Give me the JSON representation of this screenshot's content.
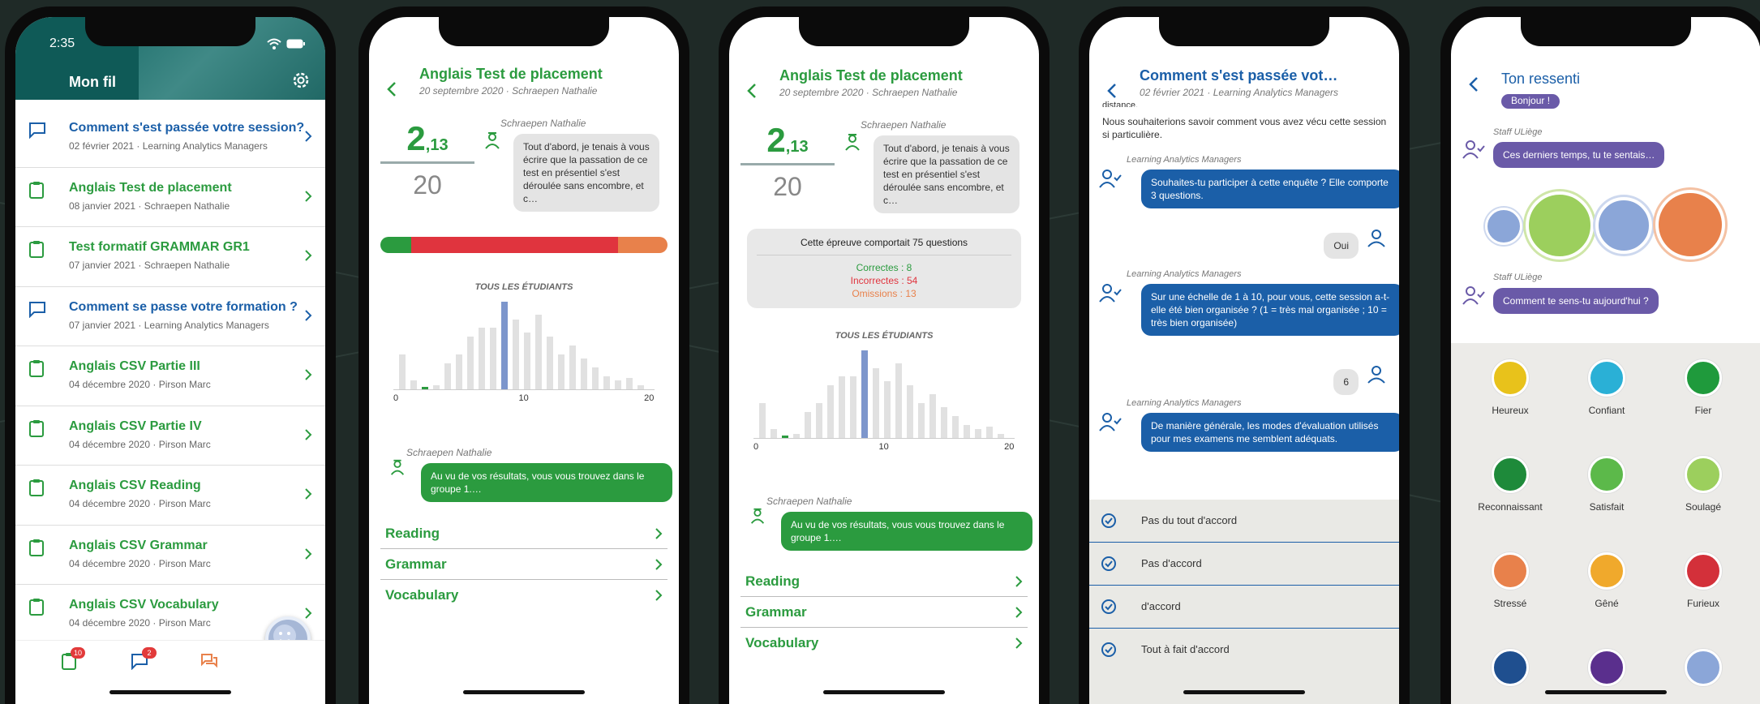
{
  "phone1": {
    "time": "2:35",
    "title": "Mon fil",
    "feed": [
      {
        "title": "Comment s'est passée votre session?",
        "date": "02 février 2021",
        "author": "Learning Analytics Managers",
        "kind": "survey"
      },
      {
        "title": "Anglais Test de placement",
        "date": "08 janvier 2021",
        "author": "Schraepen Nathalie",
        "kind": "test"
      },
      {
        "title": "Test formatif GRAMMAR GR1",
        "date": "07 janvier 2021",
        "author": "Schraepen Nathalie",
        "kind": "test"
      },
      {
        "title": "Comment se passe votre formation ?",
        "date": "07 janvier 2021",
        "author": "Learning Analytics Managers",
        "kind": "survey"
      },
      {
        "title": "Anglais CSV Partie III",
        "date": "04 décembre 2020",
        "author": "Pirson Marc",
        "kind": "test"
      },
      {
        "title": "Anglais CSV Partie IV",
        "date": "04 décembre 2020",
        "author": "Pirson Marc",
        "kind": "test"
      },
      {
        "title": "Anglais CSV Reading",
        "date": "04 décembre 2020",
        "author": "Pirson Marc",
        "kind": "test"
      },
      {
        "title": "Anglais CSV Grammar",
        "date": "04 décembre 2020",
        "author": "Pirson Marc",
        "kind": "test"
      },
      {
        "title": "Anglais CSV Vocabulary",
        "date": "04 décembre 2020",
        "author": "Pirson Marc",
        "kind": "test"
      }
    ],
    "tabs": {
      "tests_badge": "10",
      "messages_badge": "2"
    },
    "sep": "·"
  },
  "test": {
    "title": "Anglais Test de placement",
    "date": "20 septembre 2020",
    "author": "Schraepen Nathalie",
    "score_int": "2",
    "score_dec": ",13",
    "score_max": "20",
    "tutor_name": "Schraepen Nathalie",
    "tutor_msg": "Tout d'abord, je tenais à vous écrire que la passation de ce test en présentiel s'est déroulée sans encombre, et c…",
    "progress": {
      "correct": 8,
      "incorrect": 54,
      "omitted": 13,
      "colors": [
        "#2b9b3f",
        "#e0343e",
        "#e8814b"
      ]
    },
    "stats_title": "Cette épreuve comportait 75 questions",
    "stat_correct": "Correctes : 8",
    "stat_incorrect": "Incorrectes : 54",
    "stat_omitted": "Omissions : 13",
    "hist_caption": "TOUS LES ÉTUDIANTS",
    "hist_ticks": [
      "0",
      "10",
      "20"
    ],
    "hist_values": [
      4,
      1,
      0.3,
      0.5,
      3,
      4,
      6,
      7,
      7,
      10,
      8,
      6.5,
      8.5,
      6,
      4,
      5,
      3.5,
      2.5,
      1.5,
      1,
      1.3,
      0.5
    ],
    "hist_highlight": 9,
    "hist_green": [
      2
    ],
    "result_msg": "Au vu de vos résultats, vous vous trouvez dans le groupe 1.…",
    "links": [
      "Reading",
      "Grammar",
      "Vocabulary"
    ]
  },
  "survey": {
    "title": "Comment s'est passée vot…",
    "date": "02 février 2021",
    "author": "Learning Analytics Managers",
    "cut_top": "distance.",
    "intro": "Nous souhaiterions savoir comment vous avez vécu cette session si particulière.",
    "sender": "Learning Analytics Managers",
    "q1": "Souhaites-tu participer à cette enquête ?  Elle comporte 3 questions.",
    "a1": "Oui",
    "q2": "Sur une échelle de 1 à 10, pour vous, cette session a-t-elle été bien organisée ? (1 = très mal organisée ; 10 = très bien organisée)",
    "a2": "6",
    "q3": "De manière générale, les modes d'évaluation utilisés pour mes examens me semblent adéquats.",
    "options": [
      "Pas du tout d'accord",
      "Pas d'accord",
      "d'accord",
      "Tout à fait d'accord"
    ]
  },
  "feeling": {
    "title": "Ton ressenti",
    "hello": "Bonjour !",
    "staff": "Staff ULiège",
    "m1": "Ces derniers temps, tu te sentais…",
    "m2": "Comment te sens-tu aujourd'hui ?",
    "emotions": [
      {
        "label": "Heureux",
        "color": "#e8c21b"
      },
      {
        "label": "Confiant",
        "color": "#2ab0d6"
      },
      {
        "label": "Fier",
        "color": "#1f9a3c"
      },
      {
        "label": "Reconnaissant",
        "color": "#1e8a3a"
      },
      {
        "label": "Satisfait",
        "color": "#5cb94a"
      },
      {
        "label": "Soulagé",
        "color": "#9ccf5d"
      },
      {
        "label": "Stressé",
        "color": "#e8814b"
      },
      {
        "label": "Gêné",
        "color": "#f0a92c"
      },
      {
        "label": "Furieux",
        "color": "#d3303a"
      },
      {
        "label": "",
        "color": "#1f4f8f"
      },
      {
        "label": "",
        "color": "#5a2f8d"
      },
      {
        "label": "",
        "color": "#8ba6d8"
      }
    ]
  }
}
